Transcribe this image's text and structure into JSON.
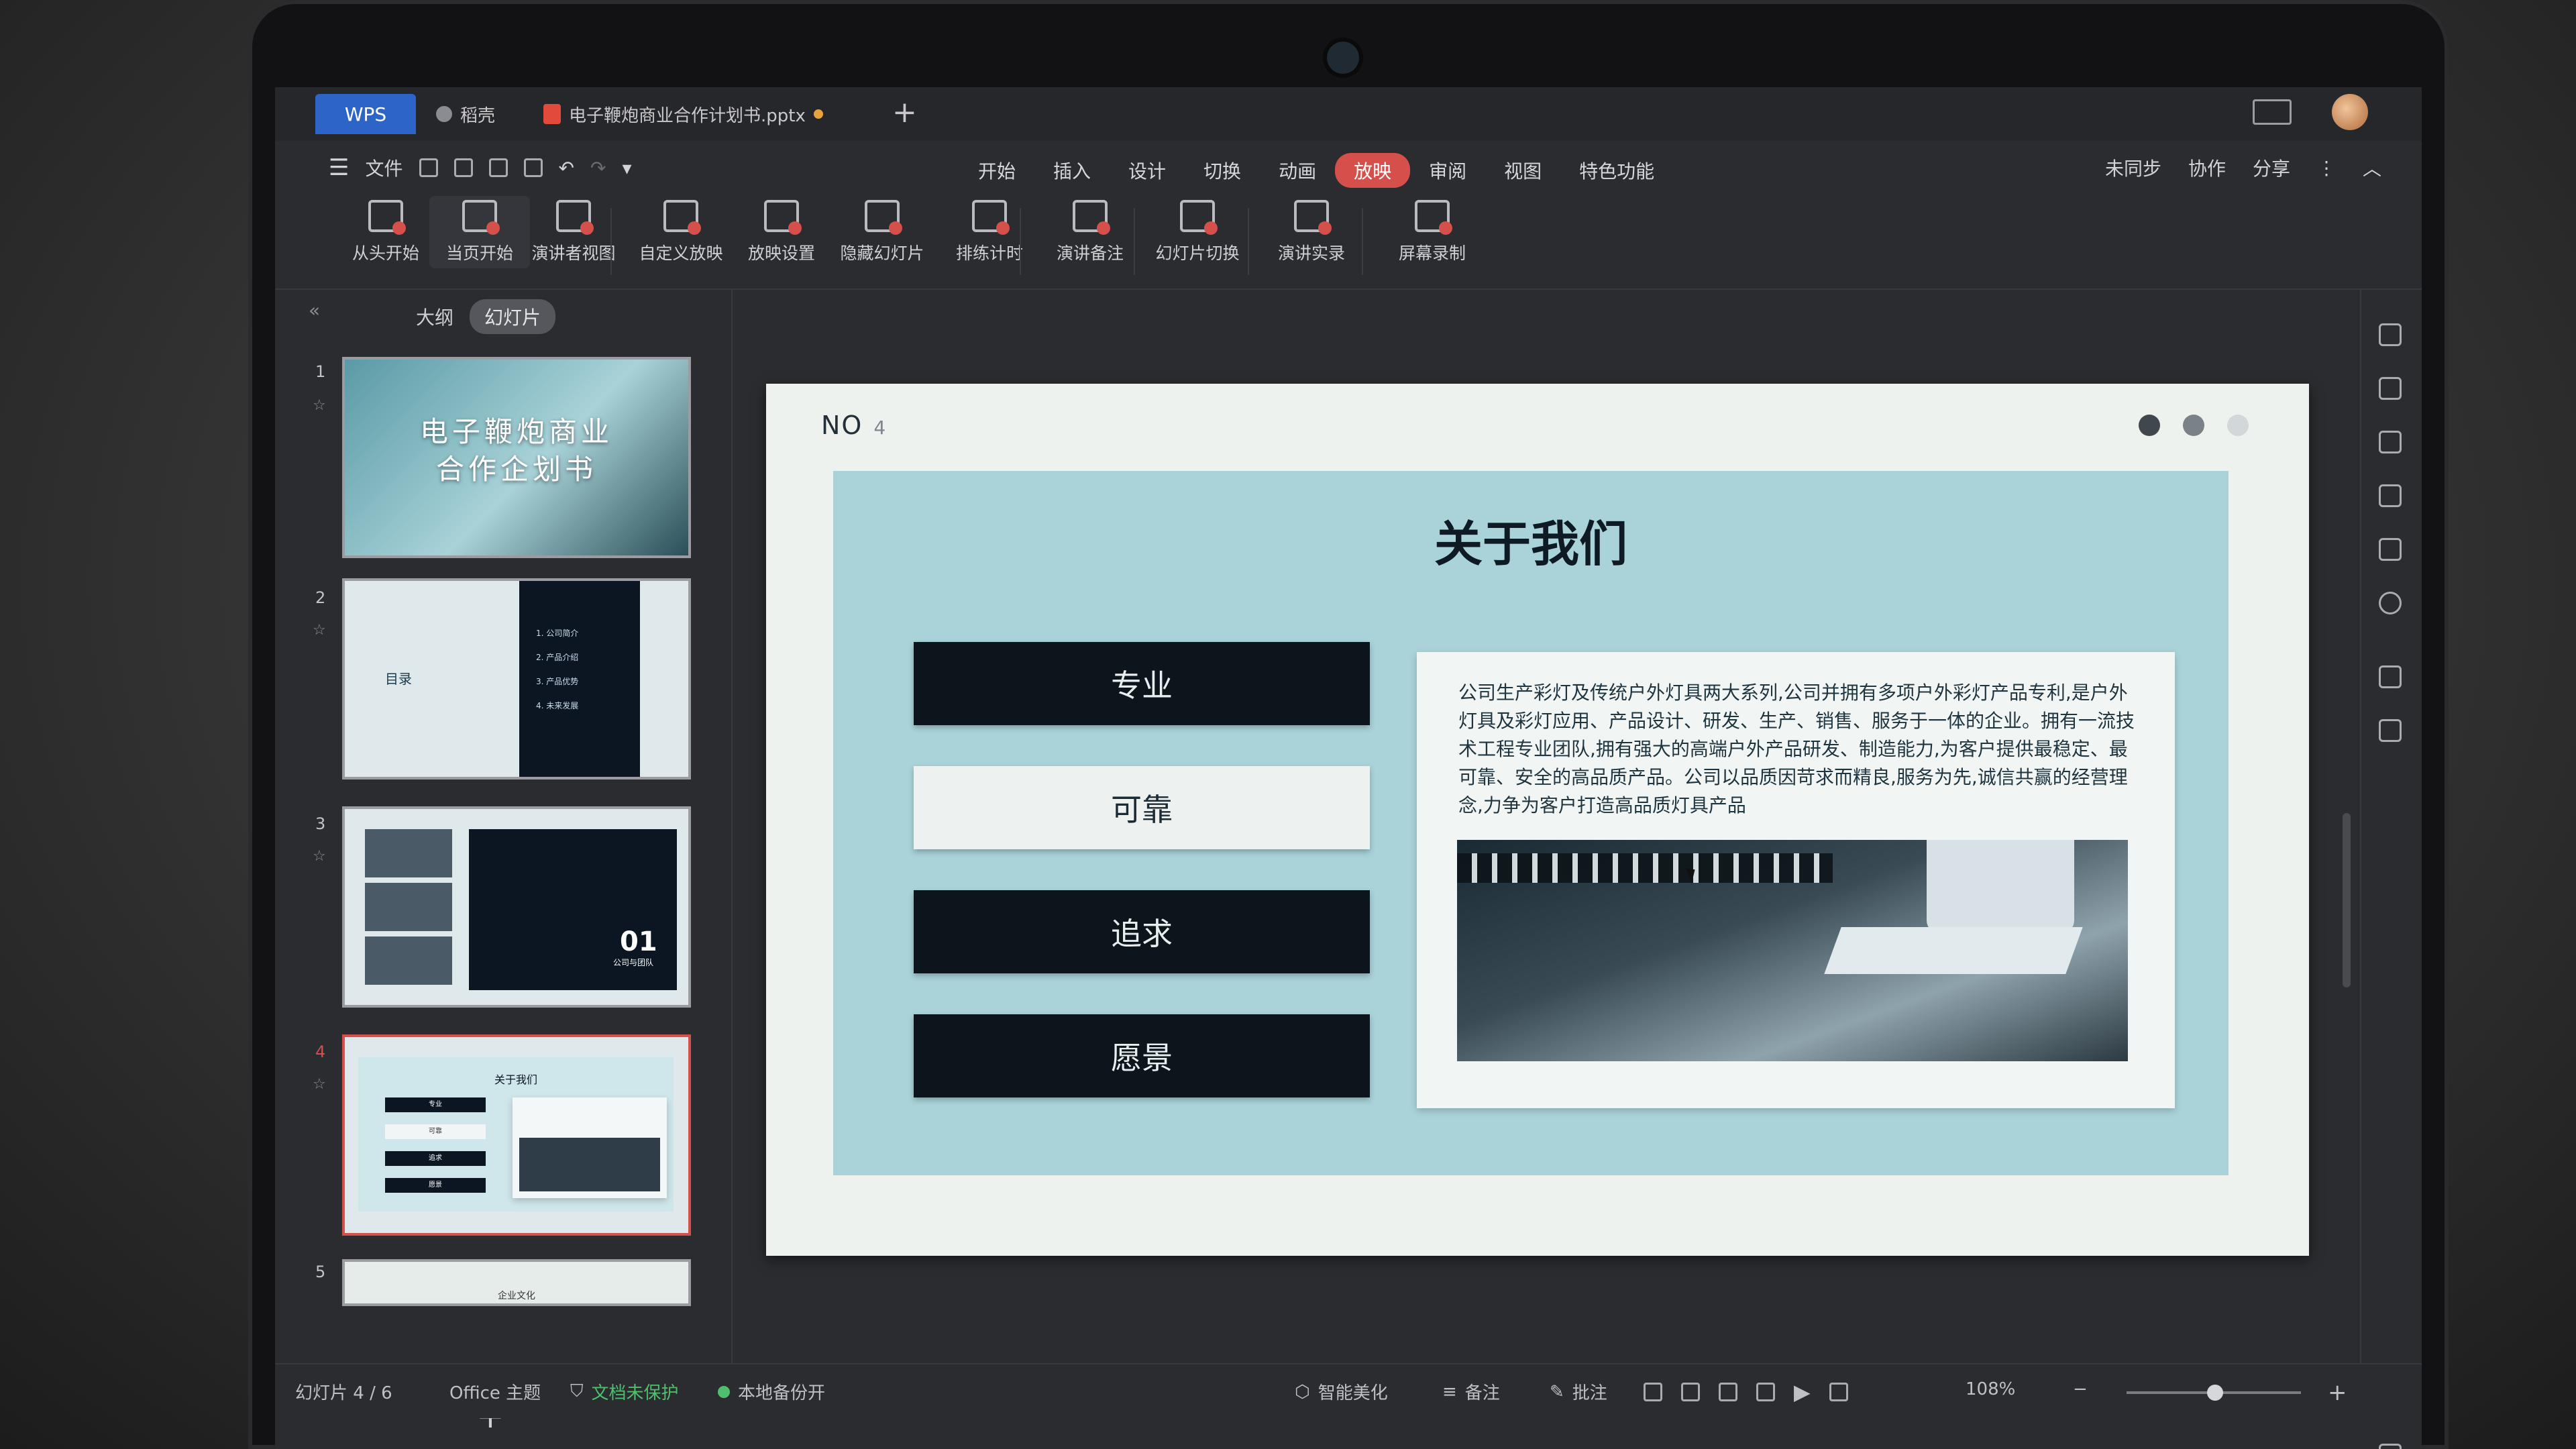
{
  "tabs": {
    "wps": "WPS",
    "daoke": "稻壳",
    "doc": "电子鞭炮商业合作计划书.pptx",
    "new": "+"
  },
  "menu": {
    "file": "文件",
    "items": [
      "开始",
      "插入",
      "设计",
      "切换",
      "动画",
      "放映",
      "审阅",
      "视图",
      "特色功能"
    ],
    "active_index": 5,
    "right": [
      "未同步",
      "协作",
      "分享"
    ]
  },
  "ribbon": [
    "从头开始",
    "当页开始",
    "演讲者视图",
    "自定义放映",
    "放映设置",
    "隐藏幻灯片",
    "排练计时",
    "演讲备注",
    "幻灯片切换",
    "演讲实录",
    "屏幕录制"
  ],
  "left_panel": {
    "tabs": [
      "大纲",
      "幻灯片"
    ],
    "collapse": "«",
    "slides": [
      {
        "num": "1",
        "title": "电子鞭炮商业\n合作企划书"
      },
      {
        "num": "2",
        "label": "目录",
        "items": [
          "1. 公司简介",
          "2. 产品介绍",
          "3. 产品优势",
          "4. 未来发展"
        ]
      },
      {
        "num": "3",
        "big": "01",
        "sub": "公司与团队"
      },
      {
        "num": "4",
        "title": "关于我们",
        "buttons": [
          "专业",
          "可靠",
          "追求",
          "愿景"
        ]
      },
      {
        "num": "5",
        "title": "企业文化"
      }
    ],
    "add": "+"
  },
  "slide": {
    "no_label": "NO",
    "no_value": "4",
    "title": "关于我们",
    "buttons": [
      "专业",
      "可靠",
      "追求",
      "愿景"
    ],
    "paragraph": "公司生产彩灯及传统户外灯具两大系列,公司并拥有多项户外彩灯产品专利,是户外灯具及彩灯应用、产品设计、研发、生产、销售、服务于一体的企业。拥有一流技术工程专业团队,拥有强大的高端户外产品研发、制造能力,为客户提供最稳定、最可靠、安全的高品质产品。公司以品质因苛求而精良,服务为先,诚信共赢的经营理念,力争为客户打造高品质灯具产品"
  },
  "status": {
    "slide_counter": "幻灯片 4 / 6",
    "theme": "Office 主题",
    "protect": "文档未保护",
    "backup": "本地备份开",
    "beautify": "智能美化",
    "notes": "备注",
    "comment": "批注",
    "zoom": "108%"
  },
  "colors": {
    "accent": "#d6504b",
    "wps_blue": "#2d64c8",
    "slide_panel": "#a9d3d9",
    "dark_button": "#0c141c"
  }
}
